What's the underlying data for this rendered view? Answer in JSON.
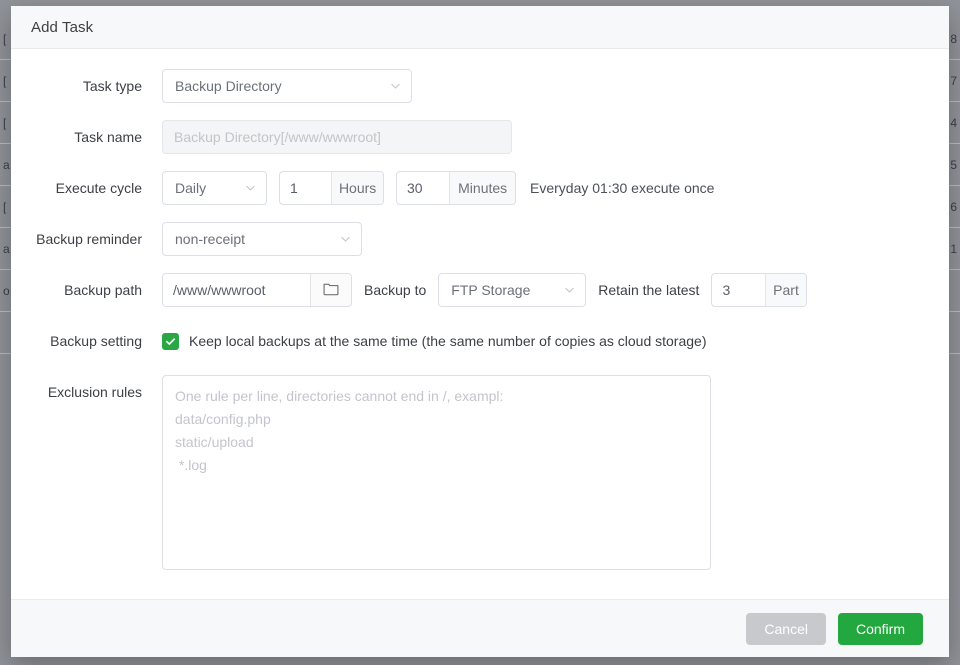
{
  "modal": {
    "title": "Add Task",
    "fields": {
      "task_type": {
        "label": "Task type",
        "value": "Backup Directory"
      },
      "task_name": {
        "label": "Task name",
        "value": "",
        "placeholder": "Backup Directory[/www/wwwroot]"
      },
      "execute_cycle": {
        "label": "Execute cycle",
        "cycle_value": "Daily",
        "hours_value": "1",
        "hours_addon": "Hours",
        "minutes_value": "30",
        "minutes_addon": "Minutes",
        "hint": "Everyday 01:30 execute once"
      },
      "backup_reminder": {
        "label": "Backup reminder",
        "value": "non-receipt"
      },
      "backup_path": {
        "label": "Backup path",
        "value": "/www/wwwroot",
        "backup_to_label": "Backup to",
        "backup_to_value": "FTP Storage",
        "retain_label": "Retain the latest",
        "retain_value": "3",
        "retain_addon": "Part"
      },
      "backup_setting": {
        "label": "Backup setting",
        "checkbox_label": "Keep local backups at the same time (the same number of copies as cloud storage)",
        "checked": true
      },
      "exclusion_rules": {
        "label": "Exclusion rules",
        "value": "",
        "placeholder": "One rule per line, directories cannot end in /, exampl:\ndata/config.php\nstatic/upload\n *.log"
      }
    },
    "footer": {
      "cancel_label": "Cancel",
      "confirm_label": "Confirm"
    }
  },
  "colors": {
    "confirm_green": "#22a83e",
    "cancel_gray": "#c8c9cc",
    "checkbox_green": "#29a745",
    "border": "#dcdfe6",
    "header_bg": "#f7f8f9"
  },
  "background": {
    "rows": [
      {
        "left": "[",
        "right": "8"
      },
      {
        "left": "[",
        "right": "7"
      },
      {
        "left": "[",
        "right": "4"
      },
      {
        "left": "a",
        "right": "5"
      },
      {
        "left": "[",
        "right": "6"
      },
      {
        "left": "a",
        "right": "1"
      },
      {
        "left": "o",
        "right": ""
      },
      {
        "left": "",
        "right": ""
      },
      {
        "left": "",
        "right": ""
      }
    ]
  }
}
